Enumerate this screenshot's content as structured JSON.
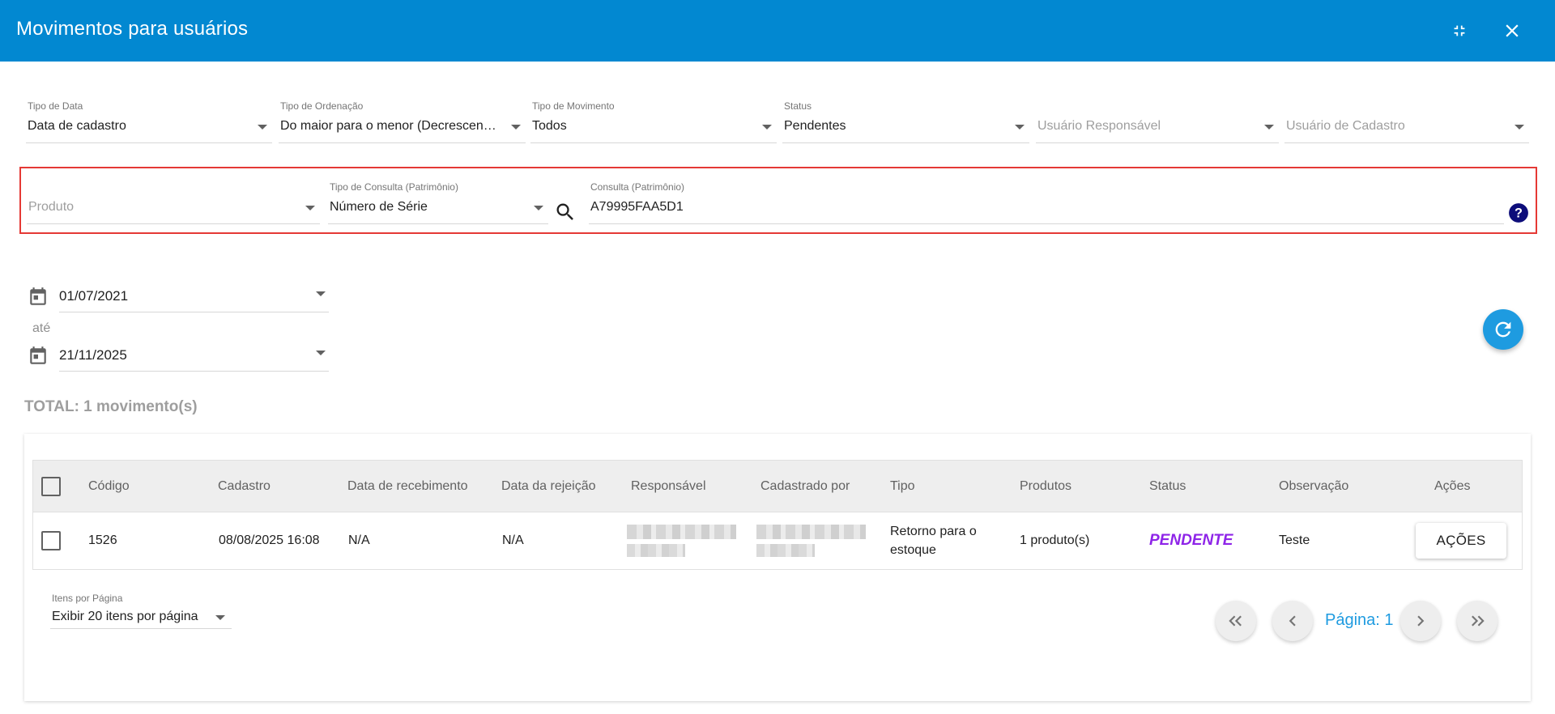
{
  "window": {
    "title": "Movimentos para usuários",
    "minimize_icon": "fullscreen-exit-icon",
    "close_icon": "close-icon"
  },
  "filters": {
    "tipo_data": {
      "label": "Tipo de Data",
      "value": "Data de cadastro"
    },
    "tipo_ordenacao": {
      "label": "Tipo de Ordenação",
      "value": "Do maior para o menor (Decrescen…"
    },
    "tipo_movimento": {
      "label": "Tipo de Movimento",
      "value": "Todos"
    },
    "status": {
      "label": "Status",
      "value": "Pendentes"
    },
    "usuario_responsavel": {
      "placeholder": "Usuário Responsável"
    },
    "usuario_cadastro": {
      "placeholder": "Usuário de Cadastro"
    }
  },
  "search": {
    "produto": {
      "placeholder": "Produto"
    },
    "tipo_consulta": {
      "label": "Tipo de Consulta (Patrimônio)",
      "value": "Número de Série"
    },
    "consulta": {
      "label": "Consulta (Patrimônio)",
      "value": "A79995FAA5D1"
    },
    "highlight_color": "#e53935"
  },
  "dates": {
    "start": "01/07/2021",
    "separator": "até",
    "end": "21/11/2025"
  },
  "total": "TOTAL: 1 movimento(s)",
  "table": {
    "headers": [
      "Código",
      "Cadastro",
      "Data de recebimento",
      "Data da rejeição",
      "Responsável",
      "Cadastrado por",
      "Tipo",
      "Produtos",
      "Status",
      "Observação",
      "Ações"
    ],
    "rows": [
      {
        "codigo": "1526",
        "cadastro": "08/08/2025 16:08",
        "recebimento": "N/A",
        "rejeicao": "N/A",
        "tipo": "Retorno para o estoque",
        "produtos": "1 produto(s)",
        "status": "PENDENTE",
        "observacao": "Teste",
        "acoes": "AÇÕES"
      }
    ]
  },
  "pagination": {
    "items_label": "Itens por Página",
    "items_value": "Exibir 20 itens por página",
    "page_label": "Página: 1"
  },
  "colors": {
    "header": "#0288d1",
    "accent": "#1e9be0",
    "pending": "#8e24e8"
  }
}
